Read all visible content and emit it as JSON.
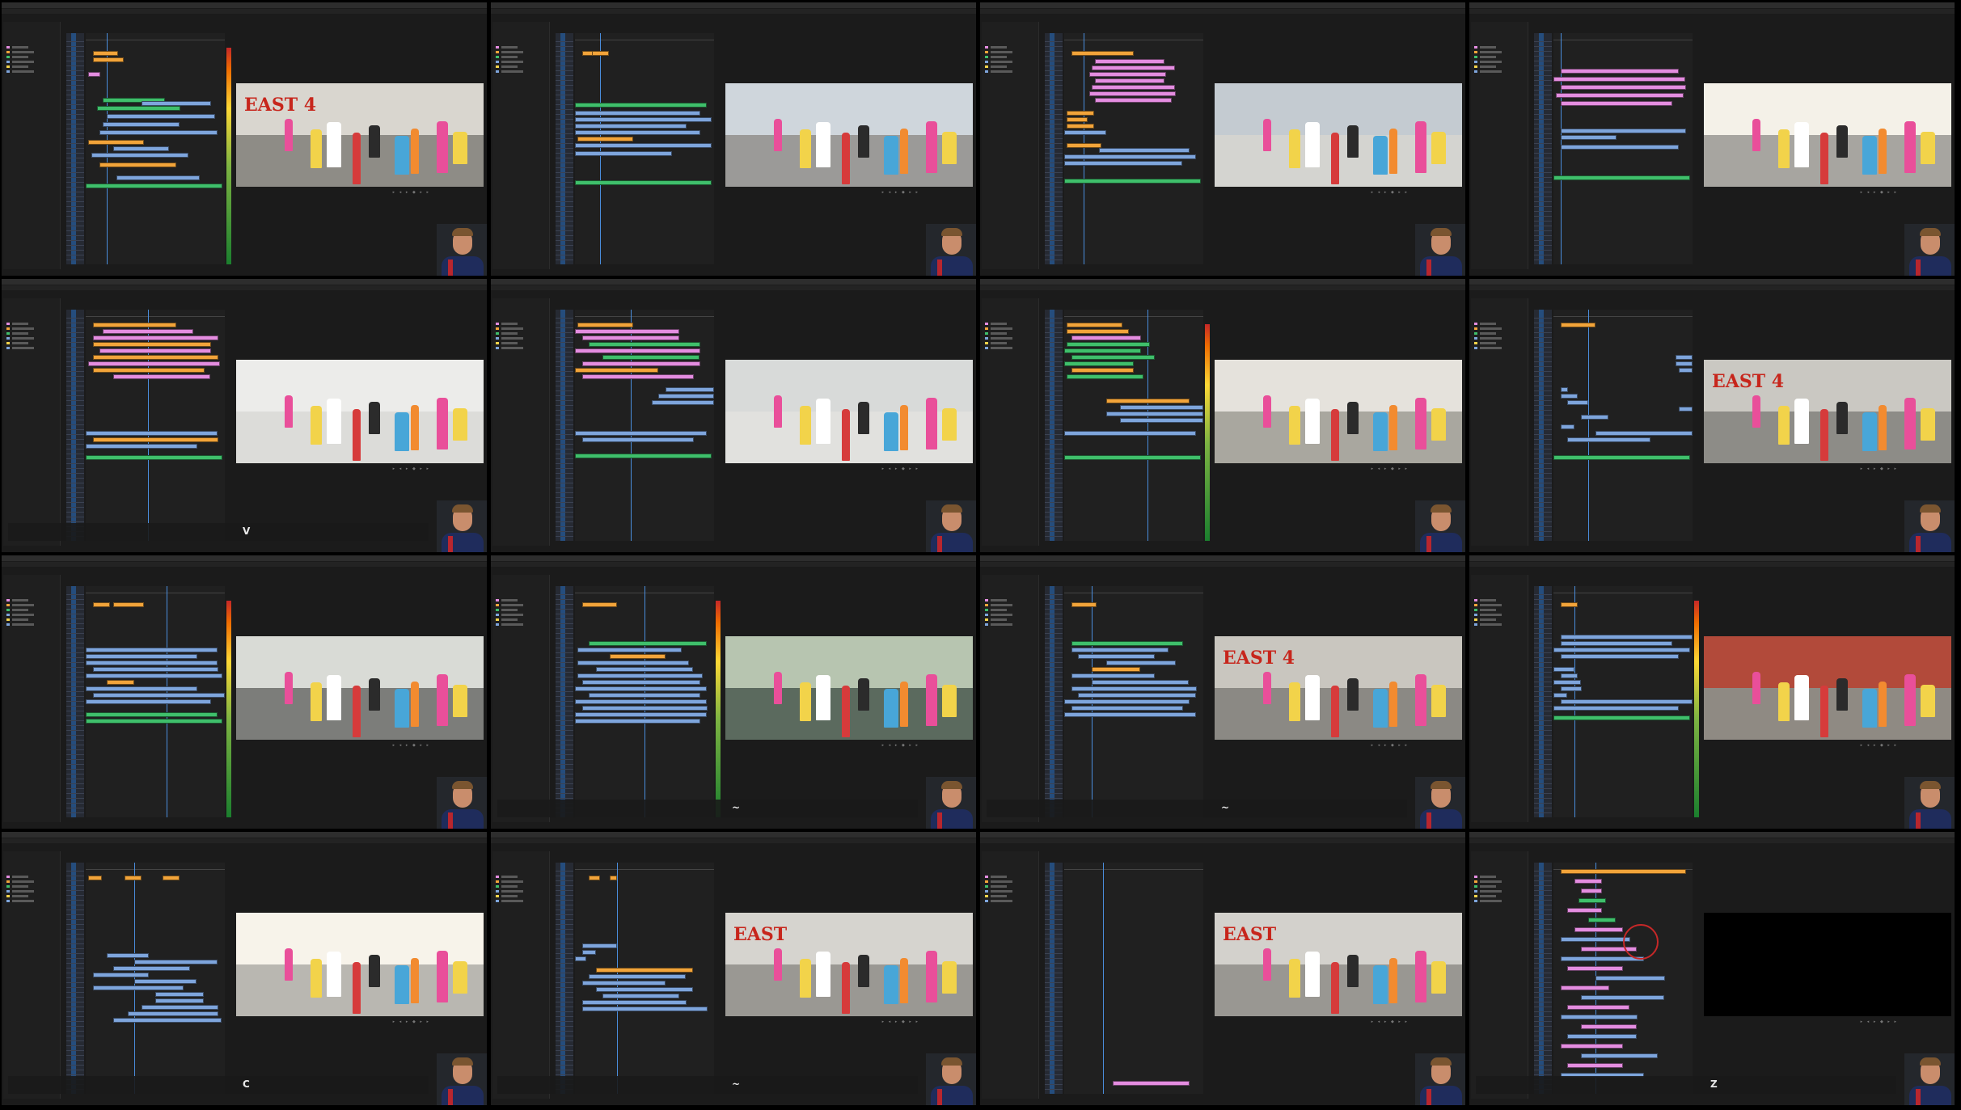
{
  "colors": {
    "blue_clip": "#7ea5dc",
    "green_clip": "#3fbf6b",
    "pink_clip": "#e48de0",
    "orange_clip": "#f2a43a",
    "accent": "#4a8ddc"
  },
  "frames": [
    {
      "scene": "garage-east4",
      "meter": true,
      "osd": "",
      "sign": "EAST 4",
      "playhead": 0.15,
      "clips": [
        [
          "o",
          0.05,
          22,
          0.18
        ],
        [
          "o",
          0.05,
          30,
          0.22
        ],
        [
          "p",
          0.02,
          48,
          0.09
        ],
        [
          "g",
          0.12,
          80,
          0.45
        ],
        [
          "b",
          0.4,
          84,
          0.5
        ],
        [
          "g",
          0.08,
          90,
          0.6
        ],
        [
          "b",
          0.15,
          100,
          0.78
        ],
        [
          "b",
          0.12,
          110,
          0.55
        ],
        [
          "b",
          0.1,
          120,
          0.85
        ],
        [
          "o",
          0.02,
          132,
          0.4
        ],
        [
          "b",
          0.2,
          140,
          0.4
        ],
        [
          "b",
          0.04,
          148,
          0.7
        ],
        [
          "o",
          0.1,
          160,
          0.55
        ],
        [
          "b",
          0.22,
          176,
          0.6
        ],
        [
          "g",
          0.0,
          186,
          0.98
        ]
      ]
    },
    {
      "scene": "street-dance",
      "meter": false,
      "osd": "",
      "sign": "",
      "playhead": 0.18,
      "clips": [
        [
          "o",
          0.05,
          22,
          0.1
        ],
        [
          "o",
          0.12,
          22,
          0.12
        ],
        [
          "g",
          0.0,
          86,
          0.95
        ],
        [
          "b",
          0.0,
          96,
          0.9
        ],
        [
          "b",
          0.0,
          104,
          0.98
        ],
        [
          "b",
          0.0,
          112,
          0.8
        ],
        [
          "b",
          0.0,
          120,
          0.9
        ],
        [
          "o",
          0.02,
          128,
          0.4
        ],
        [
          "b",
          0.0,
          136,
          0.98
        ],
        [
          "b",
          0.0,
          146,
          0.7
        ],
        [
          "g",
          0.0,
          182,
          0.98
        ]
      ]
    },
    {
      "scene": "rooftop-dance",
      "meter": false,
      "osd": "",
      "sign": "",
      "playhead": 0.14,
      "clips": [
        [
          "o",
          0.05,
          22,
          0.45
        ],
        [
          "p",
          0.22,
          32,
          0.5
        ],
        [
          "p",
          0.2,
          40,
          0.6
        ],
        [
          "p",
          0.18,
          48,
          0.55
        ],
        [
          "p",
          0.22,
          56,
          0.5
        ],
        [
          "p",
          0.2,
          64,
          0.6
        ],
        [
          "p",
          0.18,
          72,
          0.62
        ],
        [
          "p",
          0.22,
          80,
          0.55
        ],
        [
          "o",
          0.02,
          96,
          0.2
        ],
        [
          "o",
          0.02,
          104,
          0.15
        ],
        [
          "o",
          0.02,
          112,
          0.2
        ],
        [
          "b",
          0.0,
          120,
          0.3
        ],
        [
          "o",
          0.02,
          136,
          0.25
        ],
        [
          "b",
          0.25,
          142,
          0.65
        ],
        [
          "b",
          0.0,
          150,
          0.95
        ],
        [
          "b",
          0.0,
          158,
          0.85
        ],
        [
          "g",
          0.0,
          180,
          0.98
        ]
      ]
    },
    {
      "scene": "backlit-jump",
      "meter": false,
      "osd": "",
      "sign": "",
      "playhead": 0.05,
      "clips": [
        [
          "p",
          0.05,
          44,
          0.85
        ],
        [
          "p",
          0.0,
          54,
          0.95
        ],
        [
          "p",
          0.05,
          64,
          0.9
        ],
        [
          "p",
          0.02,
          74,
          0.92
        ],
        [
          "p",
          0.05,
          84,
          0.8
        ],
        [
          "b",
          0.05,
          118,
          0.9
        ],
        [
          "b",
          0.05,
          126,
          0.4
        ],
        [
          "b",
          0.05,
          138,
          0.85
        ],
        [
          "g",
          0.0,
          176,
          0.98
        ]
      ]
    },
    {
      "scene": "aerial-rooftop",
      "meter": false,
      "osd": "V",
      "sign": "",
      "playhead": 0.45,
      "clips": [
        [
          "o",
          0.05,
          16,
          0.6
        ],
        [
          "p",
          0.12,
          24,
          0.65
        ],
        [
          "p",
          0.05,
          32,
          0.9
        ],
        [
          "o",
          0.05,
          40,
          0.85
        ],
        [
          "p",
          0.1,
          48,
          0.8
        ],
        [
          "o",
          0.05,
          56,
          0.9
        ],
        [
          "p",
          0.02,
          64,
          0.95
        ],
        [
          "o",
          0.05,
          72,
          0.8
        ],
        [
          "p",
          0.2,
          80,
          0.7
        ],
        [
          "b",
          0.0,
          150,
          0.95
        ],
        [
          "o",
          0.05,
          158,
          0.9
        ],
        [
          "b",
          0.0,
          166,
          0.8
        ],
        [
          "g",
          0.0,
          180,
          0.98
        ]
      ]
    },
    {
      "scene": "aerial-rooftop-wide",
      "meter": false,
      "osd": "",
      "sign": "",
      "playhead": 0.4,
      "clips": [
        [
          "o",
          0.02,
          16,
          0.4
        ],
        [
          "p",
          0.0,
          24,
          0.75
        ],
        [
          "p",
          0.05,
          32,
          0.7
        ],
        [
          "g",
          0.1,
          40,
          0.8
        ],
        [
          "p",
          0.0,
          48,
          0.9
        ],
        [
          "g",
          0.2,
          56,
          0.7
        ],
        [
          "p",
          0.05,
          64,
          0.85
        ],
        [
          "o",
          0.0,
          72,
          0.6
        ],
        [
          "p",
          0.05,
          80,
          0.8
        ],
        [
          "b",
          0.65,
          96,
          0.35
        ],
        [
          "b",
          0.6,
          104,
          0.4
        ],
        [
          "b",
          0.55,
          112,
          0.45
        ],
        [
          "b",
          0.0,
          150,
          0.95
        ],
        [
          "b",
          0.05,
          158,
          0.8
        ],
        [
          "g",
          0.0,
          178,
          0.98
        ]
      ]
    },
    {
      "scene": "doorway-dance",
      "meter": true,
      "osd": "",
      "sign": "",
      "playhead": 0.6,
      "clips": [
        [
          "o",
          0.02,
          16,
          0.4
        ],
        [
          "o",
          0.02,
          24,
          0.45
        ],
        [
          "p",
          0.05,
          32,
          0.5
        ],
        [
          "g",
          0.02,
          40,
          0.6
        ],
        [
          "g",
          0.0,
          48,
          0.55
        ],
        [
          "g",
          0.05,
          56,
          0.6
        ],
        [
          "g",
          0.0,
          64,
          0.5
        ],
        [
          "o",
          0.05,
          72,
          0.45
        ],
        [
          "g",
          0.02,
          80,
          0.55
        ],
        [
          "o",
          0.3,
          110,
          0.6
        ],
        [
          "b",
          0.4,
          118,
          0.6
        ],
        [
          "b",
          0.3,
          126,
          0.7
        ],
        [
          "b",
          0.4,
          134,
          0.6
        ],
        [
          "b",
          0.0,
          150,
          0.95
        ],
        [
          "g",
          0.0,
          180,
          0.98
        ]
      ]
    },
    {
      "scene": "garage-trio",
      "meter": false,
      "osd": "",
      "sign": "EAST 4",
      "playhead": 0.25,
      "clips": [
        [
          "o",
          0.05,
          16,
          0.25
        ],
        [
          "b",
          0.88,
          56,
          0.12
        ],
        [
          "b",
          0.88,
          64,
          0.12
        ],
        [
          "b",
          0.9,
          72,
          0.1
        ],
        [
          "b",
          0.05,
          96,
          0.05
        ],
        [
          "b",
          0.05,
          104,
          0.12
        ],
        [
          "b",
          0.1,
          112,
          0.15
        ],
        [
          "b",
          0.9,
          120,
          0.1
        ],
        [
          "b",
          0.2,
          130,
          0.2
        ],
        [
          "b",
          0.05,
          142,
          0.1
        ],
        [
          "b",
          0.3,
          150,
          0.7
        ],
        [
          "b",
          0.1,
          158,
          0.6
        ],
        [
          "g",
          0.0,
          180,
          0.98
        ]
      ]
    },
    {
      "scene": "street-parade",
      "meter": true,
      "osd": "",
      "sign": "",
      "playhead": 0.58,
      "clips": [
        [
          "o",
          0.05,
          20,
          0.12
        ],
        [
          "o",
          0.2,
          20,
          0.22
        ],
        [
          "b",
          0.0,
          76,
          0.95
        ],
        [
          "b",
          0.0,
          84,
          0.8
        ],
        [
          "b",
          0.0,
          92,
          0.95
        ],
        [
          "b",
          0.05,
          100,
          0.9
        ],
        [
          "b",
          0.0,
          108,
          0.98
        ],
        [
          "o",
          0.15,
          116,
          0.2
        ],
        [
          "b",
          0.0,
          124,
          0.8
        ],
        [
          "b",
          0.05,
          132,
          0.95
        ],
        [
          "b",
          0.0,
          140,
          0.9
        ],
        [
          "g",
          0.0,
          156,
          0.95
        ],
        [
          "g",
          0.0,
          164,
          0.98
        ]
      ]
    },
    {
      "scene": "stairs-girls",
      "meter": true,
      "osd": "~",
      "sign": "",
      "playhead": 0.5,
      "clips": [
        [
          "o",
          0.05,
          20,
          0.25
        ],
        [
          "g",
          0.1,
          68,
          0.85
        ],
        [
          "b",
          0.02,
          76,
          0.75
        ],
        [
          "o",
          0.25,
          84,
          0.4
        ],
        [
          "b",
          0.02,
          92,
          0.8
        ],
        [
          "b",
          0.15,
          100,
          0.7
        ],
        [
          "b",
          0.02,
          108,
          0.9
        ],
        [
          "b",
          0.05,
          116,
          0.85
        ],
        [
          "b",
          0.0,
          124,
          0.95
        ],
        [
          "b",
          0.1,
          132,
          0.8
        ],
        [
          "b",
          0.0,
          140,
          0.95
        ],
        [
          "b",
          0.05,
          148,
          0.9
        ],
        [
          "b",
          0.0,
          156,
          0.95
        ],
        [
          "b",
          0.0,
          164,
          0.9
        ]
      ]
    },
    {
      "scene": "garage-run",
      "meter": false,
      "osd": "~",
      "sign": "EAST 4",
      "playhead": 0.2,
      "clips": [
        [
          "o",
          0.05,
          20,
          0.18
        ],
        [
          "g",
          0.05,
          68,
          0.8
        ],
        [
          "b",
          0.05,
          76,
          0.7
        ],
        [
          "b",
          0.1,
          84,
          0.55
        ],
        [
          "b",
          0.3,
          92,
          0.5
        ],
        [
          "o",
          0.2,
          100,
          0.35
        ],
        [
          "b",
          0.05,
          108,
          0.6
        ],
        [
          "b",
          0.2,
          116,
          0.7
        ],
        [
          "b",
          0.05,
          124,
          0.9
        ],
        [
          "b",
          0.1,
          132,
          0.85
        ],
        [
          "b",
          0.0,
          140,
          0.9
        ],
        [
          "b",
          0.05,
          148,
          0.8
        ],
        [
          "b",
          0.0,
          156,
          0.95
        ]
      ]
    },
    {
      "scene": "wall-walk",
      "meter": true,
      "osd": "",
      "sign": "",
      "playhead": 0.15,
      "clips": [
        [
          "o",
          0.05,
          20,
          0.12
        ],
        [
          "b",
          0.05,
          60,
          0.95
        ],
        [
          "b",
          0.05,
          68,
          0.8
        ],
        [
          "b",
          0.0,
          76,
          0.98
        ],
        [
          "b",
          0.05,
          84,
          0.85
        ],
        [
          "b",
          0.0,
          100,
          0.15
        ],
        [
          "b",
          0.05,
          108,
          0.12
        ],
        [
          "b",
          0.0,
          116,
          0.2
        ],
        [
          "b",
          0.05,
          124,
          0.15
        ],
        [
          "b",
          0.0,
          132,
          0.1
        ],
        [
          "b",
          0.05,
          140,
          0.95
        ],
        [
          "b",
          0.0,
          148,
          0.9
        ],
        [
          "g",
          0.0,
          160,
          0.98
        ]
      ]
    },
    {
      "scene": "flare-dancers",
      "meter": false,
      "osd": "C",
      "sign": "",
      "playhead": 0.35,
      "clips": [
        [
          "o",
          0.02,
          16,
          0.1
        ],
        [
          "o",
          0.28,
          16,
          0.12
        ],
        [
          "o",
          0.55,
          16,
          0.12
        ],
        [
          "b",
          0.15,
          112,
          0.3
        ],
        [
          "b",
          0.35,
          120,
          0.6
        ],
        [
          "b",
          0.2,
          128,
          0.55
        ],
        [
          "b",
          0.05,
          136,
          0.4
        ],
        [
          "b",
          0.35,
          144,
          0.45
        ],
        [
          "b",
          0.05,
          152,
          0.65
        ],
        [
          "b",
          0.5,
          160,
          0.35
        ],
        [
          "b",
          0.5,
          168,
          0.35
        ],
        [
          "b",
          0.4,
          176,
          0.55
        ],
        [
          "b",
          0.3,
          184,
          0.65
        ],
        [
          "b",
          0.2,
          192,
          0.78
        ]
      ]
    },
    {
      "scene": "garage-closeup",
      "meter": false,
      "osd": "~",
      "sign": "EAST",
      "playhead": 0.3,
      "clips": [
        [
          "o",
          0.1,
          16,
          0.08
        ],
        [
          "o",
          0.25,
          16,
          0.05
        ],
        [
          "b",
          0.05,
          100,
          0.25
        ],
        [
          "b",
          0.05,
          108,
          0.1
        ],
        [
          "b",
          0.0,
          116,
          0.08
        ],
        [
          "o",
          0.15,
          130,
          0.7
        ],
        [
          "b",
          0.1,
          138,
          0.7
        ],
        [
          "b",
          0.05,
          146,
          0.6
        ],
        [
          "b",
          0.15,
          154,
          0.7
        ],
        [
          "b",
          0.2,
          162,
          0.55
        ],
        [
          "b",
          0.05,
          170,
          0.75
        ],
        [
          "b",
          0.05,
          178,
          0.9
        ]
      ]
    },
    {
      "scene": "garage-closeup-2",
      "meter": false,
      "osd": "",
      "sign": "EAST",
      "playhead": 0.28,
      "clips": [
        [
          "p",
          0.35,
          270,
          0.55
        ]
      ]
    },
    {
      "scene": "black",
      "meter": false,
      "osd": "Z",
      "sign": "",
      "playhead": 0.3,
      "clips": [
        [
          "o",
          0.05,
          8,
          0.9
        ],
        [
          "p",
          0.15,
          20,
          0.2
        ],
        [
          "p",
          0.2,
          32,
          0.15
        ],
        [
          "g",
          0.18,
          44,
          0.2
        ],
        [
          "p",
          0.1,
          56,
          0.25
        ],
        [
          "g",
          0.25,
          68,
          0.2
        ],
        [
          "p",
          0.15,
          80,
          0.35
        ],
        [
          "b",
          0.05,
          92,
          0.5
        ],
        [
          "p",
          0.2,
          104,
          0.4
        ],
        [
          "b",
          0.05,
          116,
          0.6
        ],
        [
          "p",
          0.1,
          128,
          0.4
        ],
        [
          "b",
          0.3,
          140,
          0.5
        ],
        [
          "p",
          0.05,
          152,
          0.35
        ],
        [
          "b",
          0.2,
          164,
          0.6
        ],
        [
          "p",
          0.1,
          176,
          0.45
        ],
        [
          "b",
          0.05,
          188,
          0.55
        ],
        [
          "p",
          0.2,
          200,
          0.4
        ],
        [
          "b",
          0.1,
          212,
          0.5
        ],
        [
          "p",
          0.05,
          224,
          0.45
        ],
        [
          "b",
          0.2,
          236,
          0.55
        ],
        [
          "p",
          0.1,
          248,
          0.4
        ],
        [
          "b",
          0.05,
          260,
          0.6
        ]
      ]
    }
  ]
}
